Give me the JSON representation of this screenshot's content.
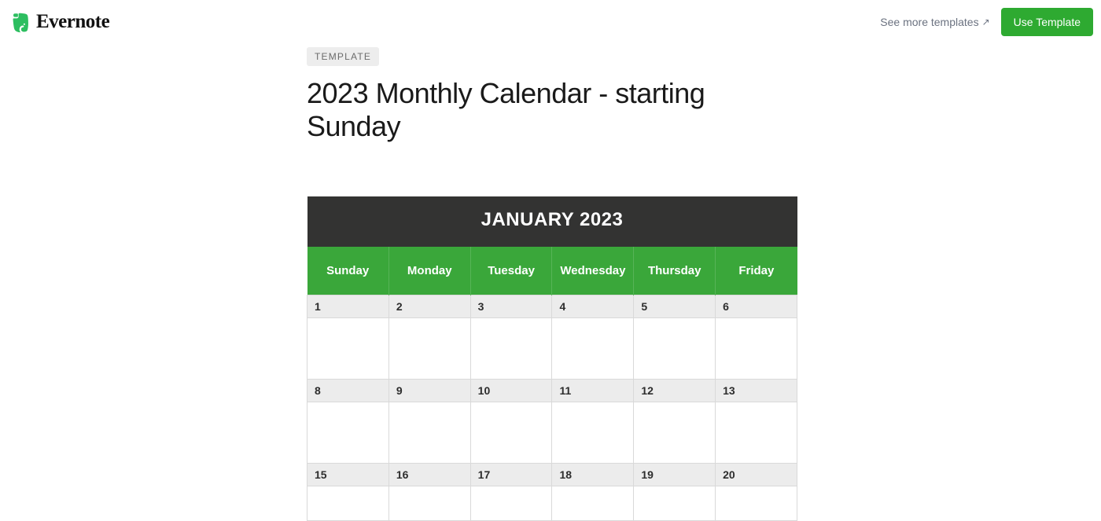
{
  "brand": {
    "name": "Evernote"
  },
  "header": {
    "see_more_label": "See more templates",
    "use_template_label": "Use Template"
  },
  "page": {
    "tag": "TEMPLATE",
    "title": "2023 Monthly Calendar - starting Sunday"
  },
  "calendar": {
    "month_title": "JANUARY 2023",
    "days": [
      "Sunday",
      "Monday",
      "Tuesday",
      "Wednesday",
      "Thursday",
      "Friday"
    ],
    "rows": [
      [
        "1",
        "2",
        "3",
        "4",
        "5",
        "6"
      ],
      [
        "8",
        "9",
        "10",
        "11",
        "12",
        "13"
      ],
      [
        "15",
        "16",
        "17",
        "18",
        "19",
        "20"
      ]
    ]
  }
}
